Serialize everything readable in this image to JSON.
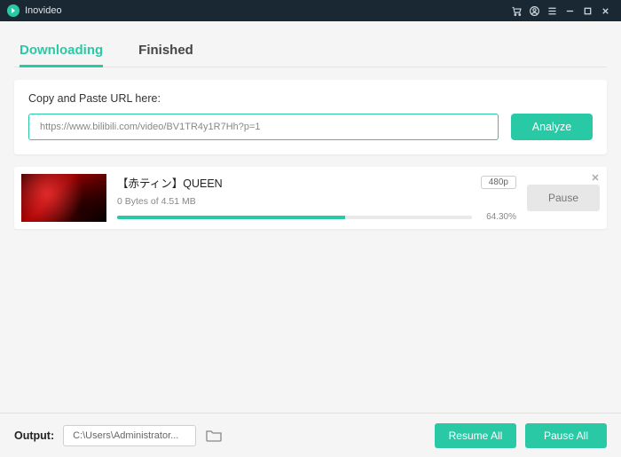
{
  "app": {
    "name": "Inovideo"
  },
  "tabs": {
    "downloading": "Downloading",
    "finished": "Finished",
    "active": "downloading"
  },
  "urlcard": {
    "label": "Copy and Paste URL here:",
    "value": "https://www.bilibili.com/video/BV1TR4y1R7Hh?p=1",
    "analyze": "Analyze"
  },
  "download": {
    "title": "【赤ティン】QUEEN",
    "resolution": "480p",
    "size_text": "0 Bytes of 4.51 MB",
    "percent": 64.3,
    "percent_text": "64.30%",
    "pause": "Pause"
  },
  "footer": {
    "output_label": "Output:",
    "output_path": "C:\\Users\\Administrator...",
    "resume_all": "Resume All",
    "pause_all": "Pause All"
  },
  "colors": {
    "accent": "#2ac9a6",
    "titlebar": "#1a2833"
  }
}
